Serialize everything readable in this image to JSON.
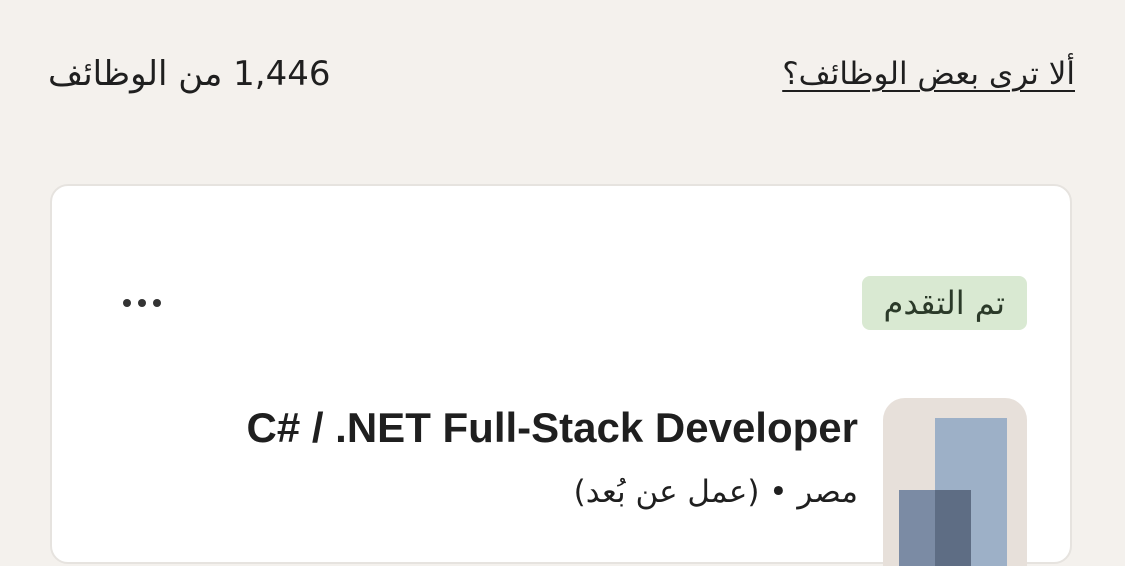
{
  "results": {
    "count": "1,446",
    "count_label": "من الوظائف",
    "missing_jobs_link": "ألا ترى بعض الوظائف؟"
  },
  "job_card": {
    "status_badge": "تم التقدم",
    "more_menu_icon": "more-horizontal-icon",
    "title": "C# / .NET Full-Stack Developer",
    "location": "مصر • (عمل عن بُعد)",
    "logo_icon": "company-logo"
  },
  "colors": {
    "background": "#f4f1ed",
    "card": "#ffffff",
    "badge_bg": "#d9e9d2",
    "logo_bg": "#e7e0da",
    "logo_light": "#9db0c7",
    "logo_dark": "#7b8ba4"
  }
}
